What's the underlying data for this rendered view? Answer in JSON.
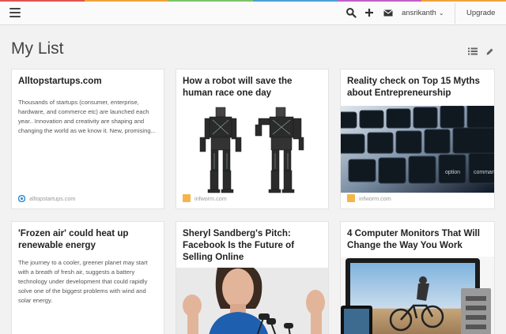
{
  "colors": {
    "stripe": [
      "#e05454",
      "#f0a33c",
      "#7cc36b",
      "#4aa0d6",
      "#c25ec7",
      "#f0a33c"
    ],
    "source_favicon_infworm": "#f5b54a",
    "source_favicon_alltop": "#3a8fd1"
  },
  "topbar": {
    "menu_icon": "hamburger-icon",
    "search_icon": "search-icon",
    "add_icon": "plus-icon",
    "inbox_icon": "envelope-icon",
    "username": "ansrikanth",
    "upgrade_label": "Upgrade"
  },
  "page": {
    "title": "My List",
    "list_view_icon": "list-view-icon",
    "edit_icon": "pencil-icon"
  },
  "cards": [
    {
      "title": "Alltopstartups.com",
      "excerpt": "Thousands of startups (consumer, enterprise, hardware, and commerce etc) are launched each year.. Innovation and creativity are shaping and changing the world as we know it. New, promising...",
      "source": "alltopstartups.com"
    },
    {
      "title": "How a robot will save the human race one day",
      "source": "infworm.com",
      "image": "robots"
    },
    {
      "title": "Reality check on Top 15 Myths about Entrepreneurship",
      "source": "infworm.com",
      "image": "keyboard",
      "keys": [
        "option",
        "command"
      ]
    },
    {
      "title": "'Frozen air' could heat up renewable energy",
      "excerpt": "The journey to a cooler, greener planet may start with a breath of fresh air, suggests a battery technology under development that could rapidly solve one of the biggest problems with wind and solar energy."
    },
    {
      "title": "Sheryl Sandberg's Pitch: Facebook Is the Future of Selling Online",
      "image": "speaker"
    },
    {
      "title": "4 Computer Monitors That Will Change the Way You Work",
      "image": "monitors"
    }
  ]
}
